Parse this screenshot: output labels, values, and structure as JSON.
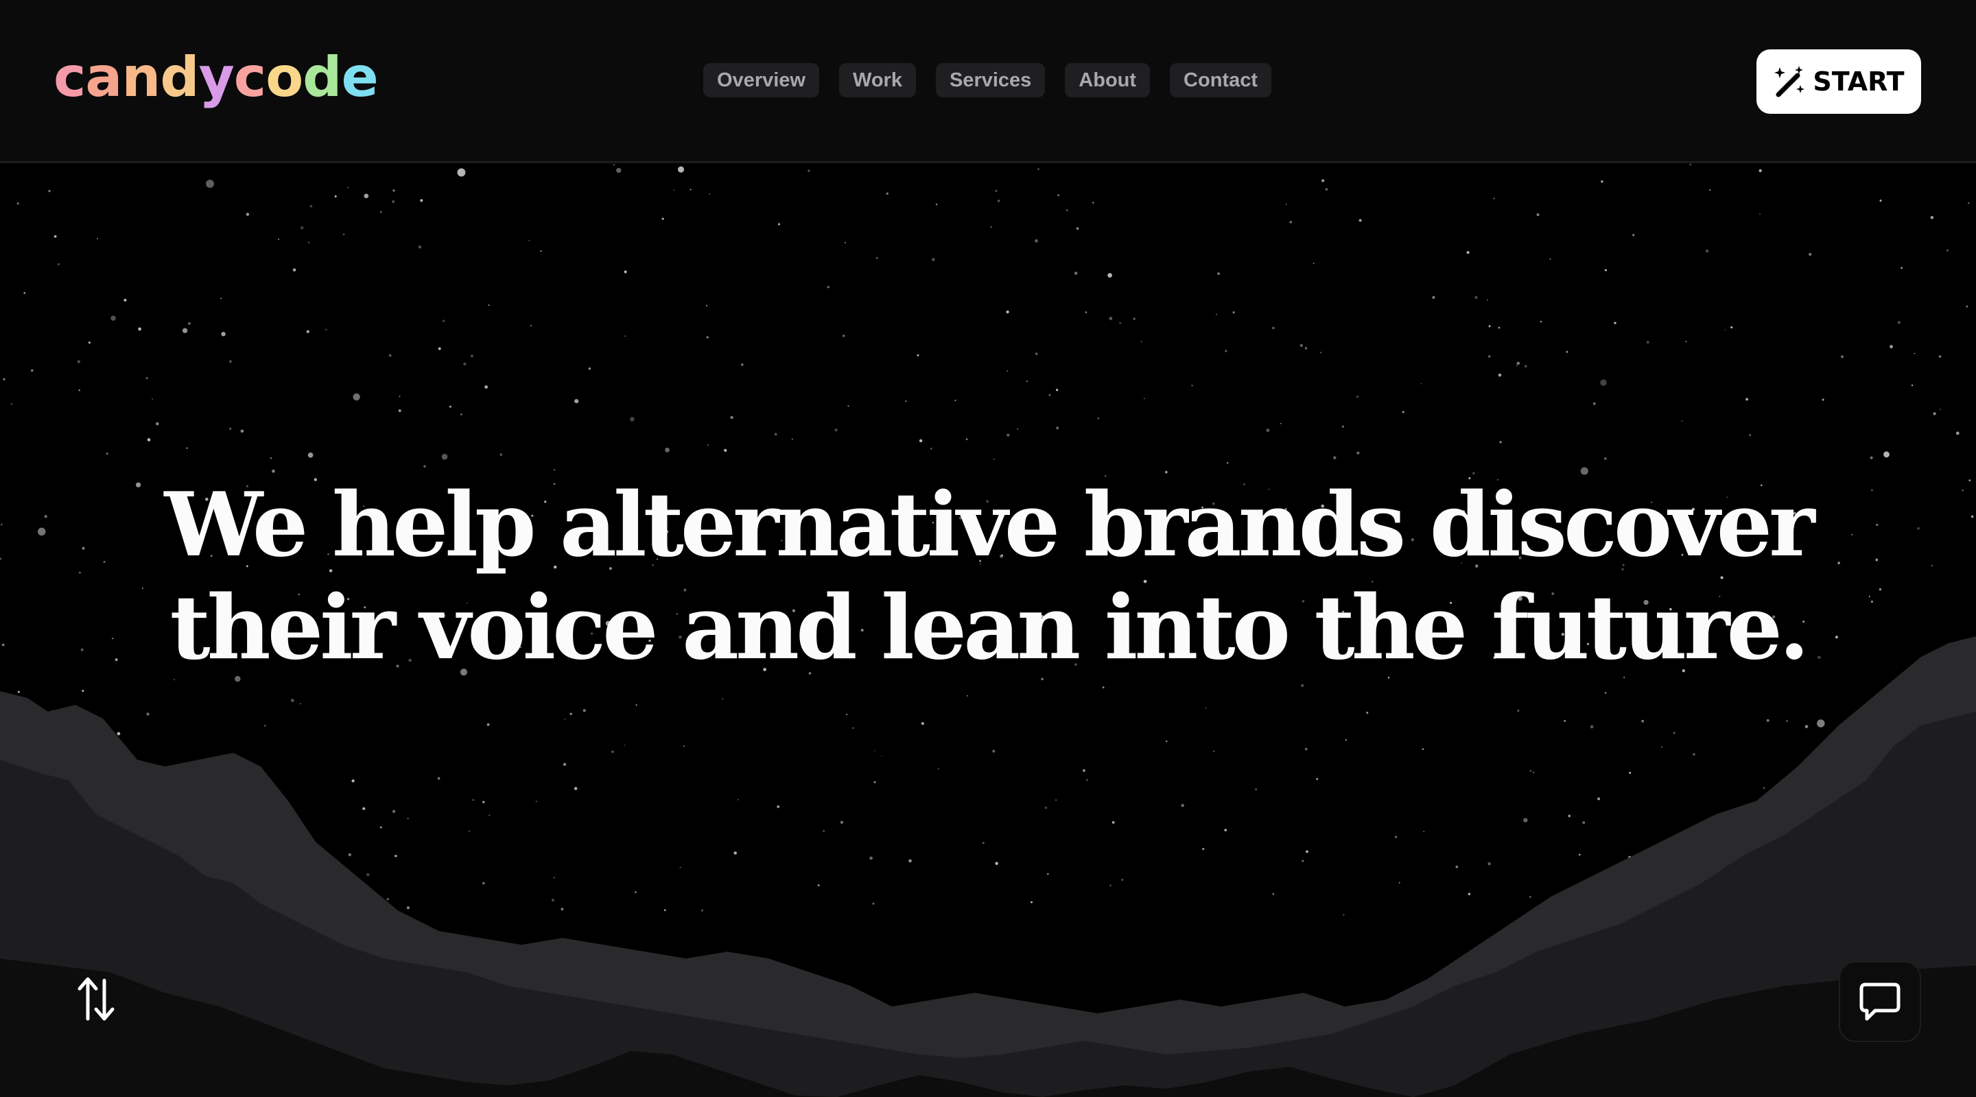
{
  "brand": {
    "logo_letters": [
      {
        "char": "c",
        "color": "#f59aa8"
      },
      {
        "char": "a",
        "color": "#f7a48e"
      },
      {
        "char": "n",
        "color": "#f8b887"
      },
      {
        "char": "d",
        "color": "#f6c98a"
      },
      {
        "char": "y",
        "color": "#d99be8"
      },
      {
        "char": "c",
        "color": "#f8a3a0"
      },
      {
        "char": "o",
        "color": "#f9d68a"
      },
      {
        "char": "d",
        "color": "#a9e79a"
      },
      {
        "char": "e",
        "color": "#7fdff0"
      }
    ]
  },
  "nav": {
    "items": [
      {
        "label": "Overview"
      },
      {
        "label": "Work"
      },
      {
        "label": "Services"
      },
      {
        "label": "About"
      },
      {
        "label": "Contact"
      }
    ]
  },
  "cta": {
    "label": "START",
    "icon": "magic-wand-icon"
  },
  "hero": {
    "line1": "We help alternative brands discover",
    "line2": "their voice and lean into the future."
  },
  "controls": {
    "scroll_icon": "sort-arrows-icon",
    "chat_icon": "chat-bubble-icon"
  },
  "colors": {
    "background": "#000000",
    "header": "#0b0b0c",
    "nav_pill": "#1f1f22",
    "nav_text": "#a8a8ad",
    "mountain_back": "#2a2a2c",
    "mountain_mid": "#1d1d1f",
    "mountain_front": "#0d0d0e"
  }
}
